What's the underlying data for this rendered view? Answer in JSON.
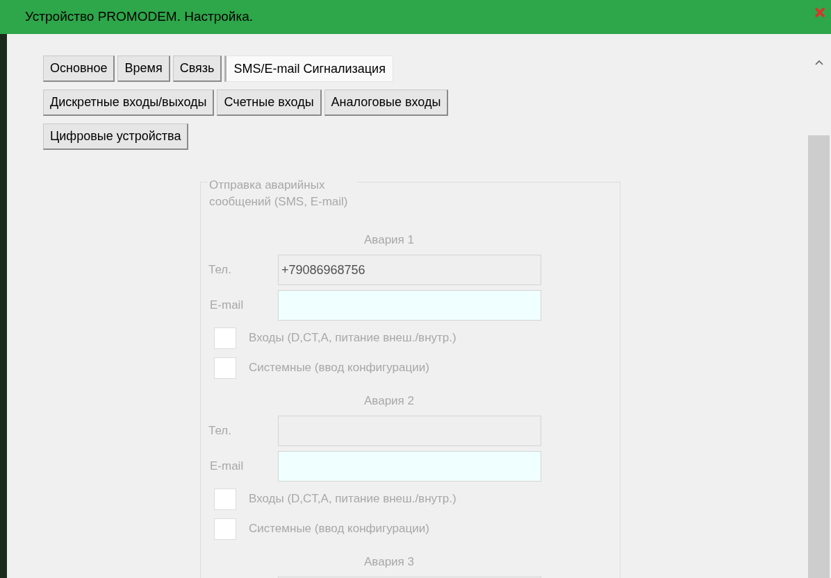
{
  "window": {
    "title": "Устройство PROMODEM. Настройка."
  },
  "tabs": [
    {
      "label": "Основное",
      "selected": false
    },
    {
      "label": "Время",
      "selected": false
    },
    {
      "label": "Связь",
      "selected": false
    },
    {
      "label": "SMS/E-mail Сигнализация",
      "selected": true
    },
    {
      "label": "Дискретные входы/выходы",
      "selected": false
    },
    {
      "label": "Счетные входы",
      "selected": false
    },
    {
      "label": "Аналоговые входы",
      "selected": false
    },
    {
      "label": "Цифровые устройства",
      "selected": false
    }
  ],
  "group": {
    "title": "Отправка аварийных сообщений (SMS, E-mail)",
    "disabled": true,
    "alarms": [
      {
        "title": "Авария 1",
        "phone_label": "Тел.",
        "phone": "+79086968756",
        "email_label": "E-mail",
        "options": [
          {
            "label": "Входы (D,CT,A, питание внеш./внутр.)",
            "checked": false
          },
          {
            "label": "Системные (ввод конфигурации)",
            "checked": false
          }
        ]
      },
      {
        "title": "Авария 2",
        "phone_label": "Тел.",
        "email_label": "E-mail",
        "options": [
          {
            "label": "Входы (D,CT,A, питание внеш./внутр.)",
            "checked": false
          },
          {
            "label": "Системные (ввод конфигурации)",
            "checked": false
          }
        ]
      },
      {
        "title": "Авария 3"
      }
    ]
  }
}
